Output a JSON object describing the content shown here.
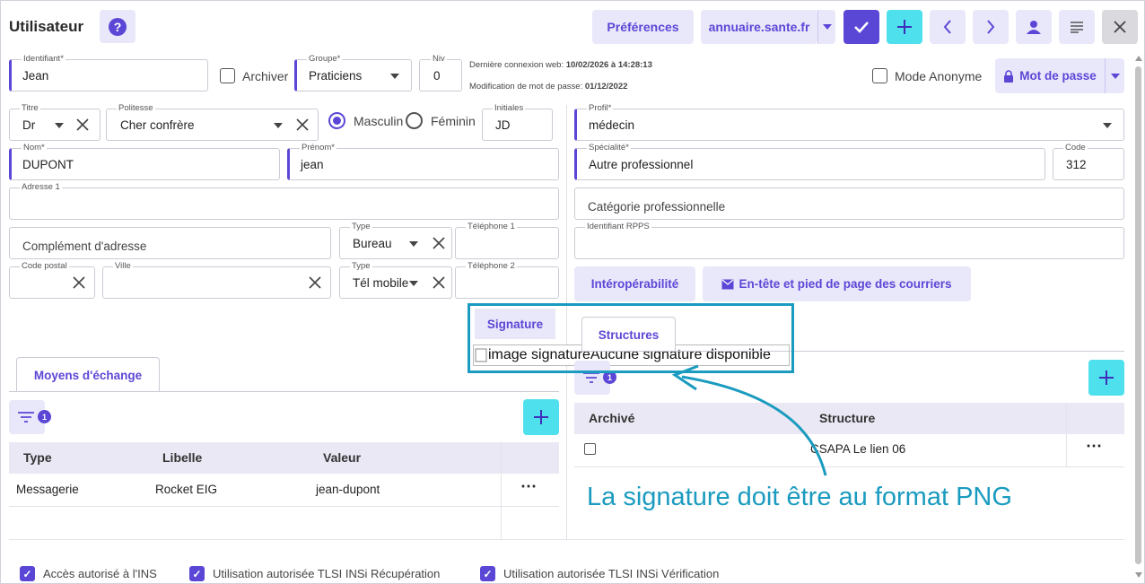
{
  "header": {
    "title": "Utilisateur",
    "help_label": "?",
    "preferences": "Préférences",
    "annuaire": "annuaire.sante.fr"
  },
  "row1": {
    "identifiant_label": "Identifiant*",
    "identifiant_value": "Jean",
    "archiver": "Archiver",
    "groupe_label": "Groupe*",
    "groupe_value": "Praticiens",
    "niveau_label": "Niv",
    "niveau_value": "0",
    "last_login": "Dernière connexion web: ",
    "last_login_value": "10/02/2026 à 14:28:13",
    "pwd_modif": "Modification de mot de passe: ",
    "pwd_modif_value": "01/12/2022",
    "mode_anonyme": "Mode Anonyme",
    "mot_de_passe": "Mot de passe"
  },
  "left": {
    "titre_label": "Titre",
    "titre_value": "Dr",
    "politesse_label": "Politesse",
    "politesse_value": "Cher confrère",
    "masculin": "Masculin",
    "feminin": "Féminin",
    "initiales_label": "Initiales",
    "initiales_value": "JD",
    "nom_label": "Nom*",
    "nom_value": "DUPONT",
    "prenom_label": "Prénom*",
    "prenom_value": "jean",
    "adresse_label": "Adresse 1",
    "complement_placeholder": "Complément d'adresse",
    "type1_label": "Type",
    "type1_value": "Bureau",
    "tel1_label": "Téléphone 1",
    "cp_label": "Code postal",
    "ville_label": "Ville",
    "type2_label": "Type",
    "type2_value": "Tél mobile",
    "tel2_label": "Téléphone 2"
  },
  "right": {
    "profil_label": "Profil*",
    "profil_value": "médecin",
    "specialite_label": "Spécialité*",
    "specialite_value": "Autre professionnel",
    "code_label": "Code",
    "code_value": "312",
    "categorie_placeholder": "Catégorie professionnelle",
    "rpps_label": "Identifiant RPPS",
    "interop": "Intéropérabilité",
    "entete": "En-tête et pied de page des courriers"
  },
  "signature": {
    "tab": "Signature",
    "image_alt": "image signature",
    "none": "Aucune signature disponible"
  },
  "exchange": {
    "tab": "Moyens d'échange",
    "filter_count": "1",
    "columns": [
      "Type",
      "Libelle",
      "Valeur"
    ],
    "rows": [
      {
        "type": "Messagerie",
        "libelle": "Rocket EIG",
        "valeur": "jean-dupont",
        "more": "⋯"
      }
    ]
  },
  "structures": {
    "tab": "Structures",
    "filter_count": "1",
    "columns": [
      "Archivé",
      "Structure"
    ],
    "rows": [
      {
        "structure": "CSAPA Le lien 06",
        "more": "⋯"
      }
    ]
  },
  "annotation": {
    "text": "La signature doit être au format PNG",
    "color": "#1a9bbf"
  },
  "footer": {
    "ins": "Accès autorisé à l'INS",
    "recup": "Utilisation autorisée TLSI INSi Récupération",
    "verif": "Utilisation autorisée TLSI INSi Vérification"
  },
  "colors": {
    "accent": "#5b47d6",
    "cyan": "#4fe0ee",
    "light": "#e9e8fb"
  }
}
